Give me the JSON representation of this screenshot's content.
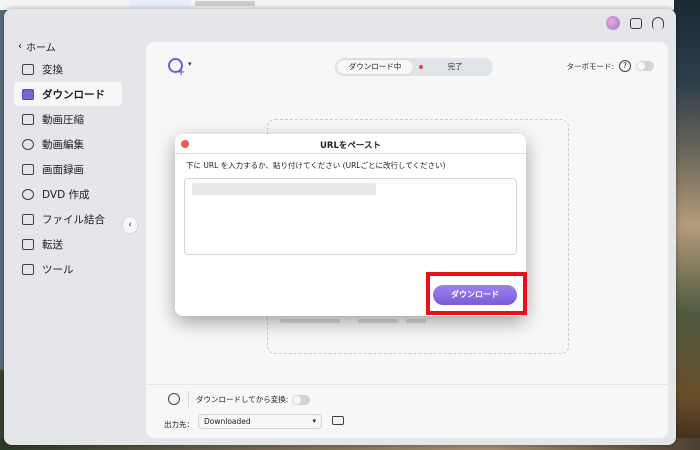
{
  "sidebar": {
    "home_label": "ホーム",
    "items": [
      {
        "label": "変換",
        "icon": "convert-icon"
      },
      {
        "label": "ダウンロード",
        "icon": "download-icon",
        "active": true
      },
      {
        "label": "動画圧縮",
        "icon": "compress-icon"
      },
      {
        "label": "動画編集",
        "icon": "scissors-icon"
      },
      {
        "label": "画面録画",
        "icon": "screen-record-icon"
      },
      {
        "label": "DVD 作成",
        "icon": "dvd-icon"
      },
      {
        "label": "ファイル結合",
        "icon": "merge-icon"
      },
      {
        "label": "転送",
        "icon": "transfer-icon"
      },
      {
        "label": "ツール",
        "icon": "tools-icon"
      }
    ]
  },
  "main": {
    "tabs": [
      {
        "label": "ダウンロード中",
        "selected": true
      },
      {
        "label": "完了"
      }
    ],
    "turbo_label": "ターボモード:",
    "turbo_help": "?",
    "download_convert_label": "ダウンロードしてから変換:",
    "output_label": "出力先：",
    "output_value": "Downloaded"
  },
  "dialog": {
    "title": "URLをペースト",
    "instruction": "下に URL を入力するか、貼り付けてください (URLごとに改行してください)",
    "button_label": "ダウンロード"
  },
  "colors": {
    "accent": "#7b5bd8",
    "highlight": "#e8101a",
    "close": "#ec5f57"
  }
}
